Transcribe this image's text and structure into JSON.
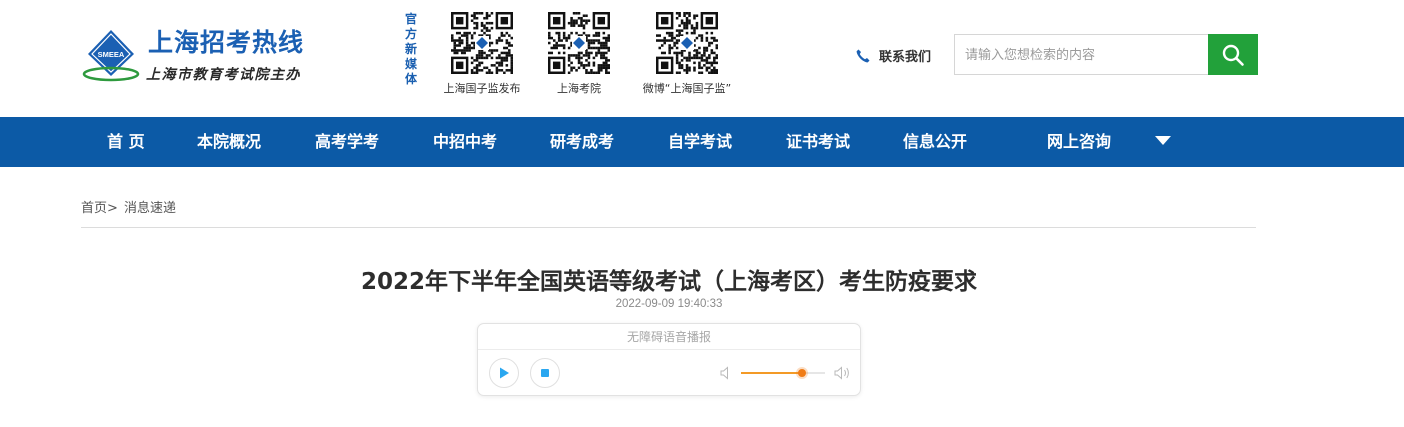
{
  "logo": {
    "emblem_text": "SMEEA",
    "title": "上海招考热线",
    "subtitle": "上海市教育考试院主办",
    "emblem_color": "#1b60b3",
    "accent_green": "#22a13a"
  },
  "media": {
    "label_chars": [
      "官",
      "方",
      "新",
      "媒",
      "体"
    ],
    "qrcodes": [
      {
        "caption": "上海国子监发布",
        "icon": "qr-code-icon"
      },
      {
        "caption": "上海考院",
        "icon": "qr-code-icon"
      },
      {
        "caption": "微博“上海国子监”",
        "icon": "qr-code-icon"
      }
    ]
  },
  "contact": {
    "label": "联系我们",
    "icon": "phone-icon"
  },
  "search": {
    "placeholder": "请输入您想检索的内容",
    "value": "",
    "icon": "search-icon"
  },
  "nav": {
    "items": [
      "首 页",
      "本院概况",
      "高考学考",
      "中招中考",
      "研考成考",
      "自学考试",
      "证书考试",
      "信息公开",
      "网上咨询"
    ],
    "more_icon": "caret-down-icon",
    "bg_color": "#0c5aa6"
  },
  "breadcrumb": {
    "home": "首页>",
    "current": "消息速递"
  },
  "article": {
    "title": "2022年下半年全国英语等级考试（上海考区）考生防疫要求",
    "date": "2022-09-09 19:40:33"
  },
  "player": {
    "header": "无障碍语音播报",
    "play_icon": "play-icon",
    "stop_icon": "stop-icon",
    "volume_low_icon": "volume-low-icon",
    "volume_high_icon": "volume-high-icon",
    "volume": 0.73,
    "accent": "#2aa7f0"
  }
}
